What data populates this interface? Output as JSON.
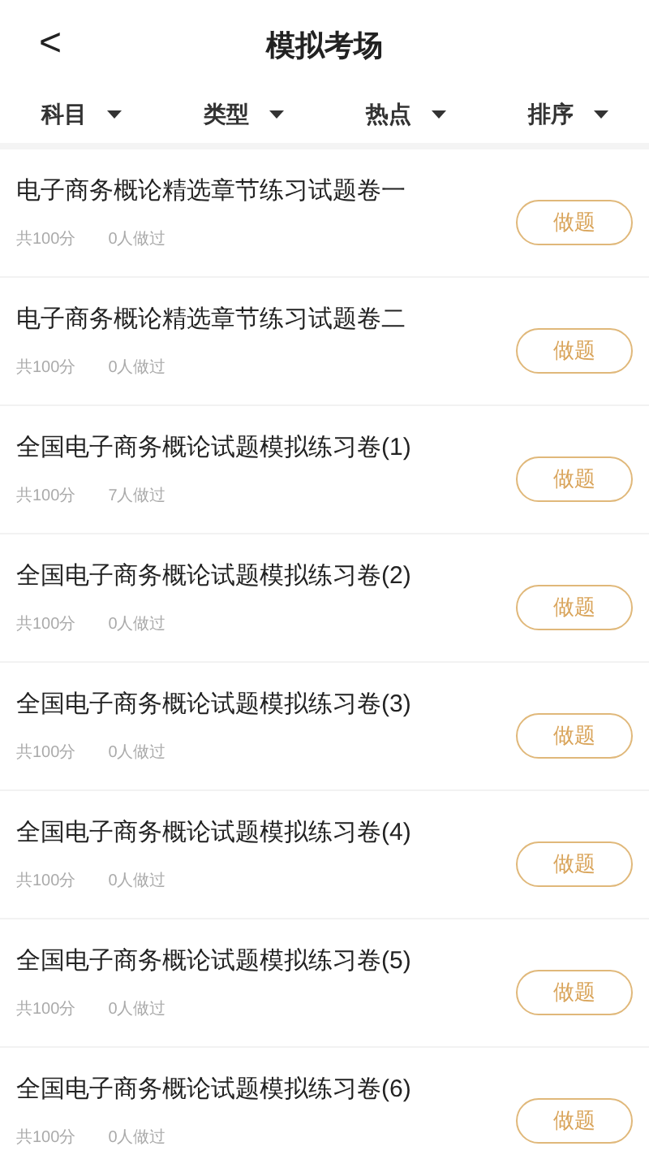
{
  "header": {
    "back": "<",
    "title": "模拟考场"
  },
  "filters": [
    {
      "label": "科目"
    },
    {
      "label": "类型"
    },
    {
      "label": "热点"
    },
    {
      "label": "排序"
    }
  ],
  "papers": [
    {
      "title": "电子商务概论精选章节练习试题卷一",
      "score": "共100分",
      "done": "0人做过",
      "action": "做题"
    },
    {
      "title": "电子商务概论精选章节练习试题卷二",
      "score": "共100分",
      "done": "0人做过",
      "action": "做题"
    },
    {
      "title": "全国电子商务概论试题模拟练习卷(1)",
      "score": "共100分",
      "done": "7人做过",
      "action": "做题"
    },
    {
      "title": "全国电子商务概论试题模拟练习卷(2)",
      "score": "共100分",
      "done": "0人做过",
      "action": "做题"
    },
    {
      "title": "全国电子商务概论试题模拟练习卷(3)",
      "score": "共100分",
      "done": "0人做过",
      "action": "做题"
    },
    {
      "title": "全国电子商务概论试题模拟练习卷(4)",
      "score": "共100分",
      "done": "0人做过",
      "action": "做题"
    },
    {
      "title": "全国电子商务概论试题模拟练习卷(5)",
      "score": "共100分",
      "done": "0人做过",
      "action": "做题"
    },
    {
      "title": "全国电子商务概论试题模拟练习卷(6)",
      "score": "共100分",
      "done": "0人做过",
      "action": "做题"
    }
  ]
}
